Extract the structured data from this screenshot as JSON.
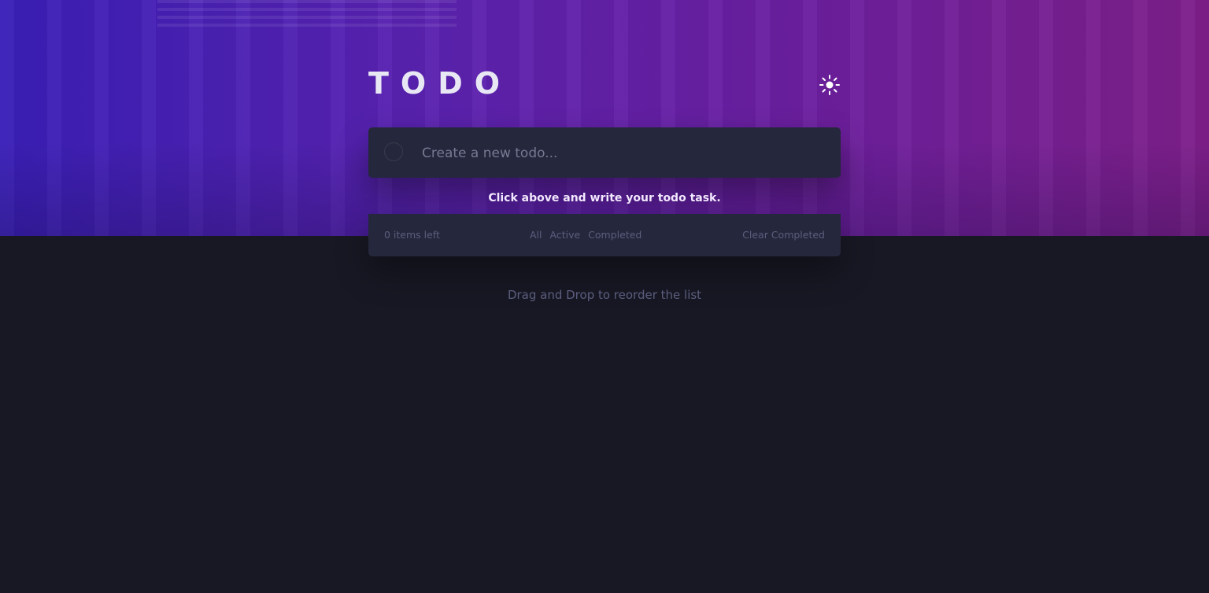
{
  "app": {
    "title": "TODO"
  },
  "theme_toggle": {
    "icon": "sun-icon"
  },
  "new_todo": {
    "placeholder": "Create a new todo...",
    "value": ""
  },
  "hint": "Click above and write your todo task.",
  "footer": {
    "items_left": "0 items left",
    "filters": {
      "all": "All",
      "active": "Active",
      "completed": "Completed"
    },
    "clear_completed": "Clear Completed"
  },
  "drag_hint": "Drag and Drop to reorder the list",
  "colors": {
    "page_bg": "#181824",
    "card_bg": "#25273c",
    "muted_text": "#5b5e7e",
    "title_text": "#e8e8f5",
    "gradient_start": "#3a1fb8",
    "gradient_end": "#7e1f8a"
  }
}
